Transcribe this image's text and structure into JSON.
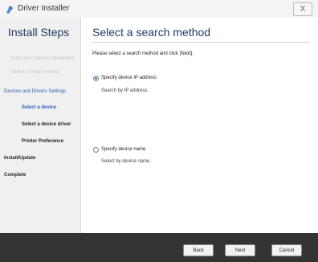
{
  "window": {
    "title": "Driver Installer",
    "close_label": "X"
  },
  "sidebar": {
    "title": "Install Steps",
    "steps": [
      {
        "label": "End-User License Agreement",
        "state": "done"
      },
      {
        "label": "Select a setup method",
        "state": "done"
      },
      {
        "label": "Devices and Drivers Settings",
        "state": "current-group"
      },
      {
        "label": "Select a device",
        "state": "current"
      },
      {
        "label": "Select a device driver",
        "state": "pending"
      },
      {
        "label": "Printer Preference",
        "state": "pending"
      },
      {
        "label": "Install/Update",
        "state": "pending"
      },
      {
        "label": "Complete",
        "state": "pending"
      }
    ]
  },
  "main": {
    "title": "Select a search method",
    "instruction": "Please select a search method and click [Next].",
    "options": [
      {
        "label": "Specify device IP address",
        "description": "Search by IP address.",
        "selected": true
      },
      {
        "label": "Specify device name",
        "description": "Select by device name.",
        "selected": false
      }
    ]
  },
  "footer": {
    "back": "Back",
    "next": "Next",
    "cancel": "Cancel"
  },
  "colors": {
    "accent": "#1f3b66",
    "current_step": "#2a62b8",
    "footer_bg": "#333333"
  }
}
